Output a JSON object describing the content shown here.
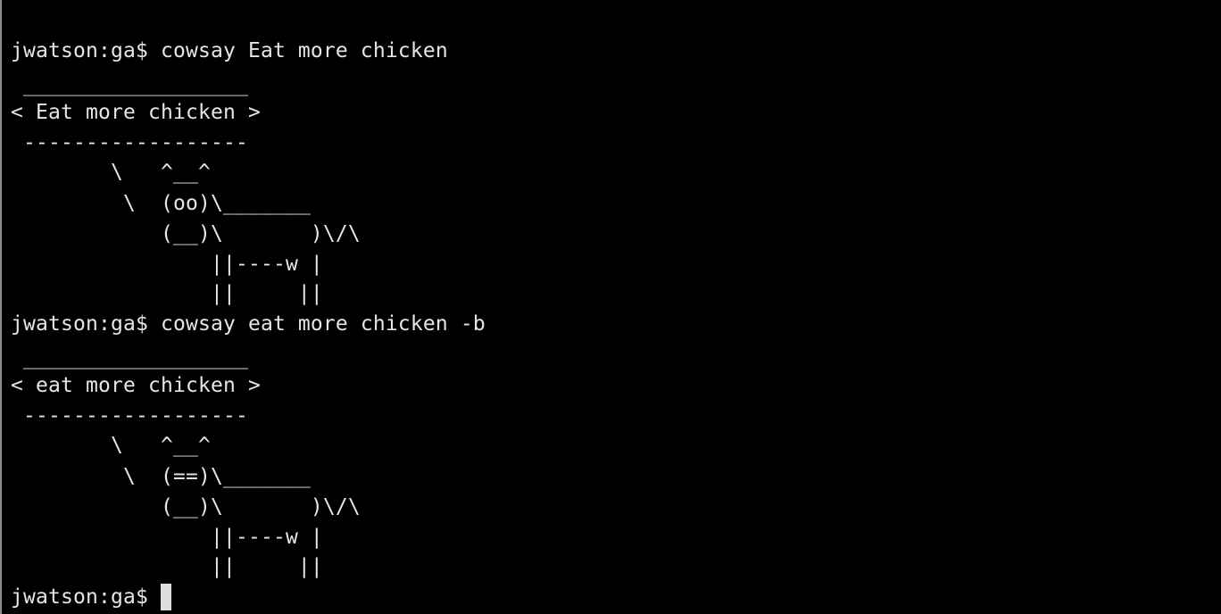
{
  "session_1": {
    "command": "jwatson:ga$ cowsay Eat more chicken",
    "bubble_top": " __________________",
    "bubble_text": "< Eat more chicken >",
    "bubble_bottom": " ------------------",
    "cow": [
      "        \\   ^__^",
      "         \\  (oo)\\_______",
      "            (__)\\       )\\/\\",
      "                ||----w |",
      "                ||     ||"
    ]
  },
  "session_2": {
    "command": "jwatson:ga$ cowsay eat more chicken -b",
    "bubble_top": " __________________",
    "bubble_text": "< eat more chicken >",
    "bubble_bottom": " ------------------",
    "cow": [
      "        \\   ^__^",
      "         \\  (==)\\_______",
      "            (__)\\       )\\/\\",
      "                ||----w |",
      "                ||     ||"
    ]
  },
  "prompt": {
    "text": "jwatson:ga$ "
  },
  "colors": {
    "background": "#000000",
    "foreground": "#e6e6e6",
    "cursor": "#dcdcdc"
  }
}
